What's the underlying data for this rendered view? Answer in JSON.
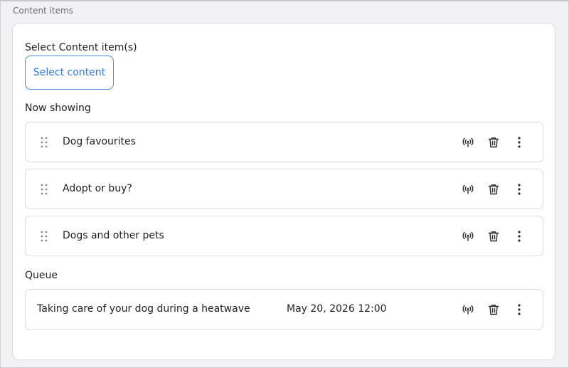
{
  "section": {
    "label": "Content items"
  },
  "select": {
    "label": "Select Content item(s)",
    "button_label": "Select content"
  },
  "now_showing": {
    "label": "Now showing",
    "items": [
      {
        "title": "Dog favourites"
      },
      {
        "title": "Adopt or buy?"
      },
      {
        "title": "Dogs and other pets"
      }
    ]
  },
  "queue": {
    "label": "Queue",
    "items": [
      {
        "title": "Taking care of your dog during a heatwave",
        "scheduled": "May 20, 2026 12:00"
      }
    ]
  },
  "icons": {
    "drag": "drag-handle-icon",
    "live": "broadcast-icon",
    "delete": "trash-icon",
    "more": "more-vertical-icon"
  },
  "colors": {
    "accent": "#2f78dc",
    "border": "#dcdce0",
    "background": "#f2f2f4"
  }
}
